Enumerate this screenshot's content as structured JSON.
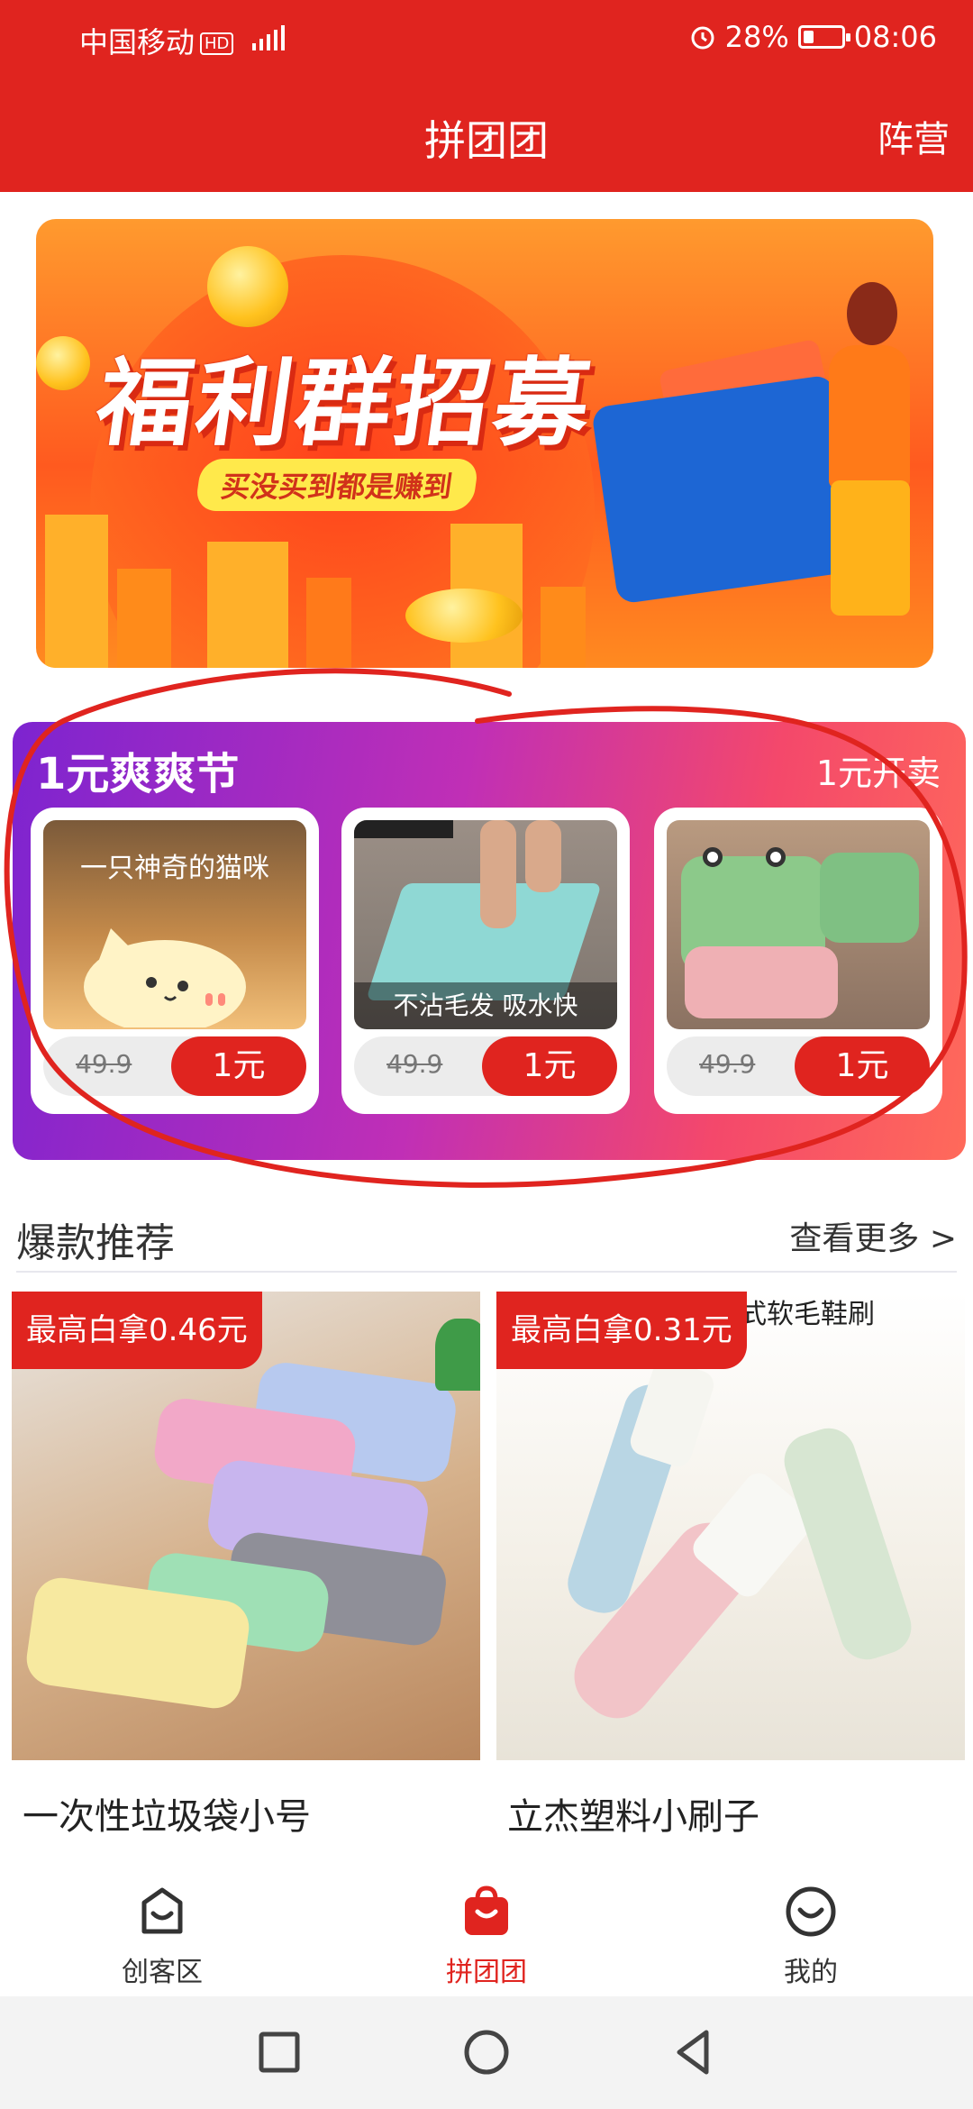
{
  "status_bar": {
    "carrier": "中国移动",
    "hd_badge": "HD",
    "battery": "28%",
    "battery_level": 0.28,
    "time": "08:06"
  },
  "header": {
    "title": "拼团团",
    "right_link": "阵营"
  },
  "banner": {
    "title": "福利群招募",
    "subtitle": "买没买到都是赚到"
  },
  "promo": {
    "title": "1元爽爽节",
    "right_text": "1元开卖",
    "items": [
      {
        "caption": "一只神奇的猫咪",
        "old_price": "49.9",
        "buy_label": "1元"
      },
      {
        "caption": "不沾毛发  吸水快",
        "old_price": "49.9",
        "buy_label": "1元"
      },
      {
        "caption": "",
        "old_price": "49.9",
        "buy_label": "1元"
      }
    ]
  },
  "section": {
    "title": "爆款推荐",
    "more": "查看更多 >"
  },
  "products": [
    {
      "tag": "最高白拿0.46元",
      "name": "一次性垃圾袋小号"
    },
    {
      "tag": "最高白拿0.31元",
      "name": "立杰塑料小刷子",
      "image_text": "式软毛鞋刷"
    }
  ],
  "tabs": [
    {
      "label": "创客区",
      "icon": "bag-smile-icon",
      "active": false
    },
    {
      "label": "拼团团",
      "icon": "bag-smile-filled-icon",
      "active": true
    },
    {
      "label": "我的",
      "icon": "smile-circle-icon",
      "active": false
    }
  ],
  "colors": {
    "brand_red": "#e0241f",
    "promo_purple": "#7d24d0",
    "promo_pink": "#f4486b"
  }
}
